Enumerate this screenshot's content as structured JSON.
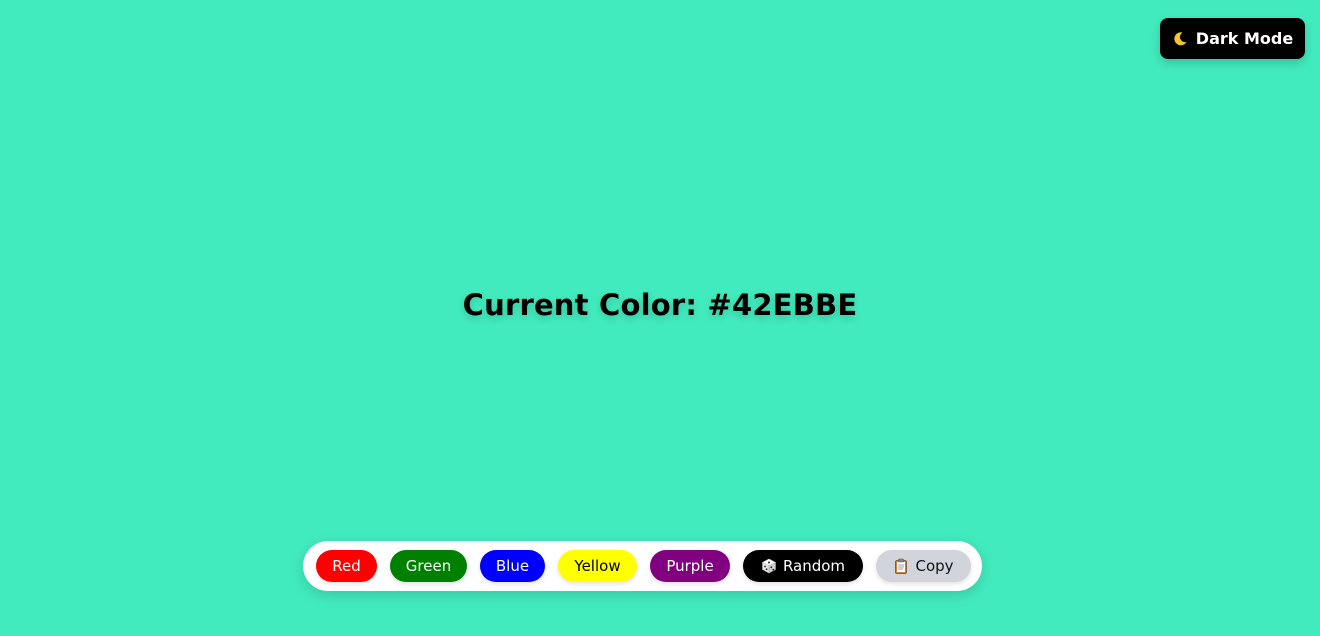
{
  "header": {
    "dark_mode_label": "Dark Mode",
    "dark_mode_icon": "moon-icon"
  },
  "main": {
    "current_color_text": "Current Color: #42EBBE",
    "current_color_hex": "#42EBBE"
  },
  "toolbar": {
    "buttons": [
      {
        "label": "Red",
        "color": "#FF0000"
      },
      {
        "label": "Green",
        "color": "#008000"
      },
      {
        "label": "Blue",
        "color": "#0000FF"
      },
      {
        "label": "Yellow",
        "color": "#FFFF00"
      },
      {
        "label": "Purple",
        "color": "#800080"
      },
      {
        "label": "Random",
        "icon": "dice-icon",
        "color": "#000000"
      },
      {
        "label": "Copy",
        "icon": "clipboard-icon",
        "color": "#D1D5DB"
      }
    ]
  },
  "colors": {
    "background": "#42EBBE",
    "toolbar_background": "#FFFFFF",
    "dark_button": "#000000"
  }
}
